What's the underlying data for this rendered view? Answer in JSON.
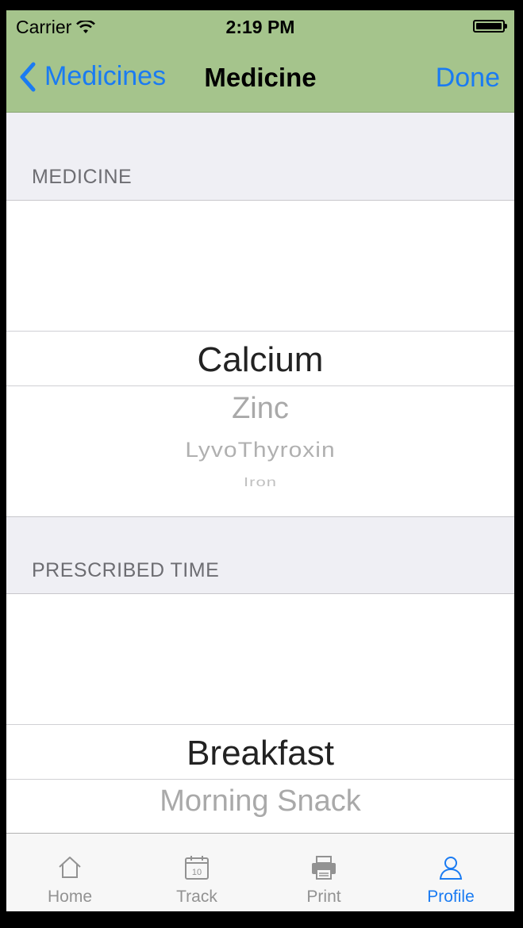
{
  "status_bar": {
    "carrier": "Carrier",
    "time": "2:19 PM",
    "battery_level": 1.0
  },
  "nav": {
    "back_label": "Medicines",
    "title": "Medicine",
    "done_label": "Done"
  },
  "medicine_section": {
    "header": "MEDICINE",
    "options": [
      "Calcium",
      "Zinc",
      "LyvoThyroxin",
      "Iron"
    ],
    "selected": "Calcium"
  },
  "time_section": {
    "header": "PRESCRIBED TIME",
    "options": [
      "Breakfast",
      "Morning Snack"
    ],
    "selected": "Breakfast"
  },
  "tabs": [
    {
      "label": "Home",
      "icon": "home-icon",
      "active": false
    },
    {
      "label": "Track",
      "icon": "calendar-icon",
      "calendar_day": "10",
      "active": false
    },
    {
      "label": "Print",
      "icon": "printer-icon",
      "active": false
    },
    {
      "label": "Profile",
      "icon": "person-icon",
      "active": true
    }
  ],
  "colors": {
    "nav_bar": "#a5c48c",
    "accent": "#1a7bf2",
    "group_background": "#efeff4"
  }
}
